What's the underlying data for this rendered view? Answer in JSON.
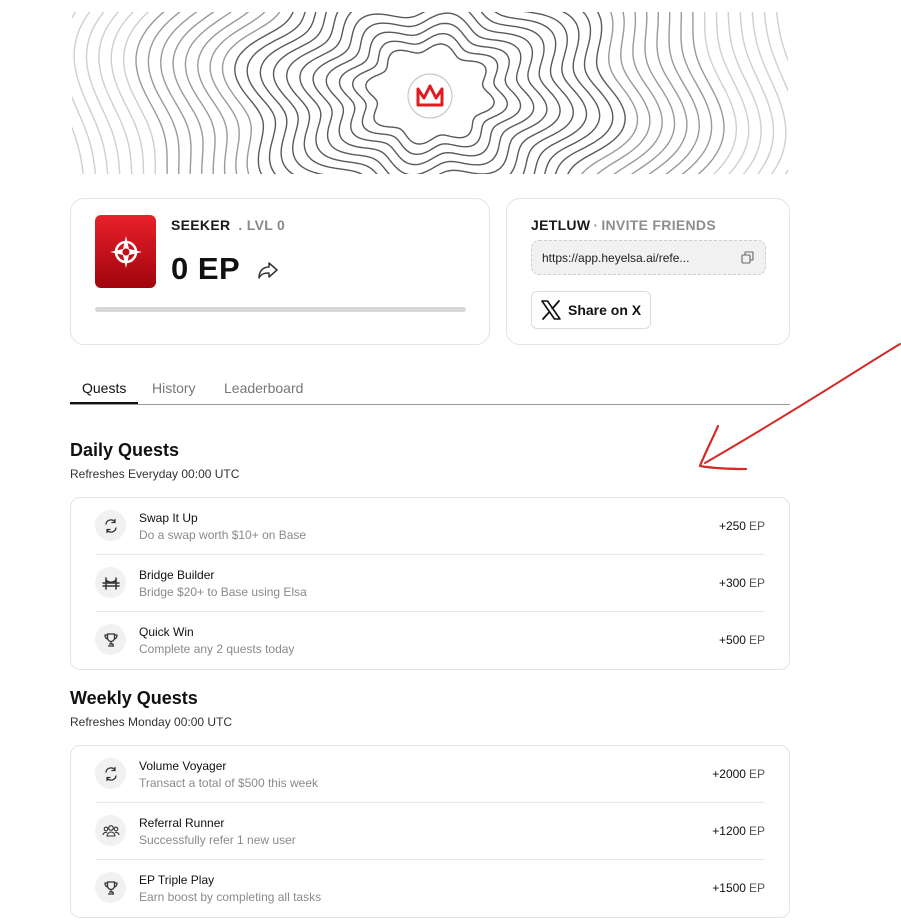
{
  "profile": {
    "rank": "SEEKER",
    "level": ". LVL 0",
    "points": "0 EP",
    "progress": 0
  },
  "invite": {
    "username": "JETLUW",
    "separator": "·",
    "label": "INVITE FRIENDS",
    "link": "https://app.heyelsa.ai/refe...",
    "share_label": "Share on X"
  },
  "tabs": [
    "Quests",
    "History",
    "Leaderboard"
  ],
  "daily": {
    "title": "Daily Quests",
    "refresh": "Refreshes Everyday 00:00 UTC",
    "quests": [
      {
        "icon": "swap-icon",
        "title": "Swap It Up",
        "desc": "Do a swap worth $10+ on Base",
        "reward": "+250",
        "unit": "EP"
      },
      {
        "icon": "bridge-icon",
        "title": "Bridge Builder",
        "desc": "Bridge $20+ to Base using Elsa",
        "reward": "+300",
        "unit": "EP"
      },
      {
        "icon": "trophy-icon",
        "title": "Quick Win",
        "desc": "Complete any 2 quests today",
        "reward": "+500",
        "unit": "EP"
      }
    ]
  },
  "weekly": {
    "title": "Weekly Quests",
    "refresh": "Refreshes Monday 00:00 UTC",
    "quests": [
      {
        "icon": "swap-icon",
        "title": "Volume Voyager",
        "desc": "Transact a total of $500 this week",
        "reward": "+2000",
        "unit": "EP"
      },
      {
        "icon": "users-icon",
        "title": "Referral Runner",
        "desc": "Successfully refer 1 new user",
        "reward": "+1200",
        "unit": "EP"
      },
      {
        "icon": "trophy-icon",
        "title": "EP Triple Play",
        "desc": "Earn boost by completing all tasks",
        "reward": "+1500",
        "unit": "EP"
      }
    ]
  },
  "colors": {
    "brand_red": "#e11b22",
    "annotation_red": "#d42a26"
  }
}
